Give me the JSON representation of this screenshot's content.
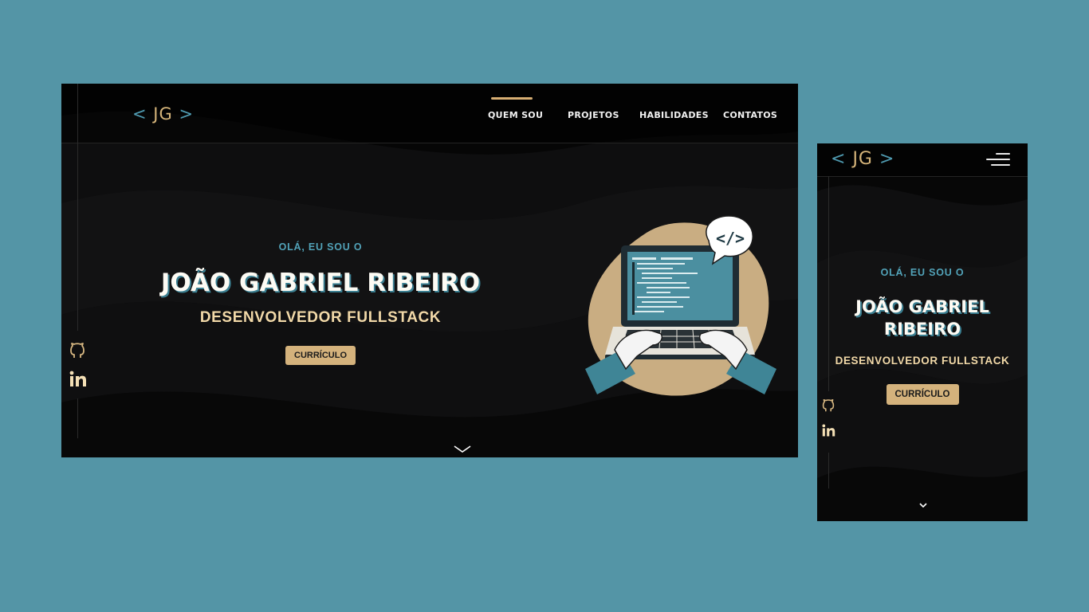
{
  "logo": {
    "open": "<",
    "initials": "JG",
    "close": ">"
  },
  "nav": {
    "items": [
      {
        "label": "QUEM SOU",
        "active": true
      },
      {
        "label": "PROJETOS",
        "active": false
      },
      {
        "label": "HABILIDADES",
        "active": false
      },
      {
        "label": "CONTATOS",
        "active": false
      }
    ]
  },
  "hero": {
    "greeting": "OLÁ, EU SOU O",
    "name": "JOÃO GABRIEL RIBEIRO",
    "name_line1": "JOÃO GABRIEL",
    "name_line2": "RIBEIRO",
    "role": "DESENVOLVEDOR FULLSTACK",
    "cta_label": "CURRÍCULO"
  },
  "social": {
    "github_icon": "github-icon",
    "linkedin_icon": "linkedin-icon"
  },
  "scroll_icon": "chevron-down-icon",
  "menu_icon": "hamburger-menu-icon",
  "illustration": "developer-laptop-code-illustration",
  "colors": {
    "backdrop": "#5495a6",
    "page_bg": "#0b0b0c",
    "accent_gold": "#d4b27c",
    "accent_teal": "#52a3b9",
    "text_light": "#fdfbf4"
  }
}
